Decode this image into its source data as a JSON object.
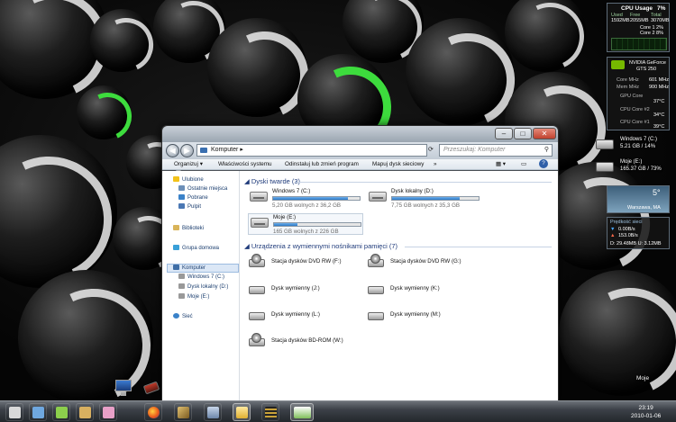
{
  "explorer": {
    "address": "Komputer",
    "search_placeholder": "Przeszukaj: Komputer",
    "toolbar": [
      "Organizuj ▾",
      "Właściwości systemu",
      "Odinstaluj lub zmień program",
      "Mapuj dysk sieciowy",
      "»"
    ],
    "nav": {
      "favorites_label": "Ulubione",
      "favorites": [
        "Ostatnie miejsca",
        "Pobrane",
        "Pulpit"
      ],
      "libraries": "Biblioteki",
      "homegroup": "Grupa domowa",
      "computer": "Komputer",
      "drives": [
        "Windows 7 (C:)",
        "Dysk lokalny (D:)",
        "Moje (E:)"
      ],
      "network": "Sieć"
    },
    "hard_drives_header": "Dyski twarde (3)",
    "hard_drives": [
      {
        "name": "Windows 7 (C:)",
        "free": "5,20 GB wolnych z 36,2 GB",
        "used_fraction": 0.86
      },
      {
        "name": "Dysk lokalny (D:)",
        "free": "7,75 GB wolnych z 35,3 GB",
        "used_fraction": 0.78
      },
      {
        "name": "Moje (E:)",
        "free": "165 GB wolnych z 226 GB",
        "used_fraction": 0.27
      }
    ],
    "removable_header": "Urządzenia z wymiennymi nośnikami pamięci (7)",
    "removable": [
      "Stacja dysków DVD RW (F:)",
      "Stacja dysków DVD RW (G:)",
      "Dysk wymienny (J:)",
      "Dysk wymienny (K:)",
      "Dysk wymienny (L:)",
      "Dysk wymienny (M:)",
      "Stacja dysków BD-ROM (W:)"
    ]
  },
  "gadgets": {
    "cpu": {
      "title": "CPU Usage",
      "percent": "7%",
      "cols": [
        "Used",
        "Free",
        "Total"
      ],
      "mem": [
        "1592MB",
        "2055MB",
        "3070MB"
      ],
      "cores": [
        "Core 1   2%",
        "Core 2   8%"
      ]
    },
    "gpu": {
      "brand": "NVIDIA GeForce",
      "model": "GTS 250",
      "rows": [
        [
          "Core MHz",
          "601 MHz"
        ],
        [
          "Mem MHz",
          "900 MHz"
        ],
        [
          "GPU Core",
          "37°C"
        ],
        [
          "CPU Core #2",
          "34°C"
        ],
        [
          "CPU Core #1",
          "39°C"
        ]
      ]
    },
    "drives": [
      {
        "name": "Windows 7 (C:)",
        "stat": "5.21 GB / 14%"
      },
      {
        "name": "Moje (E:)",
        "stat": "165.37 GB / 73%"
      }
    ],
    "weather": {
      "temp": "5°",
      "city": "Warszawa, MA"
    },
    "network": {
      "title": "Prędkość sieci",
      "down": "0.00B/s",
      "up": "153.0B/s",
      "totals": "D: 29.48MB   U: 3.12MB"
    }
  },
  "desktop": {
    "moje_label": "Moje"
  },
  "clock": {
    "time": "23:19",
    "date": "2010-01-06"
  }
}
